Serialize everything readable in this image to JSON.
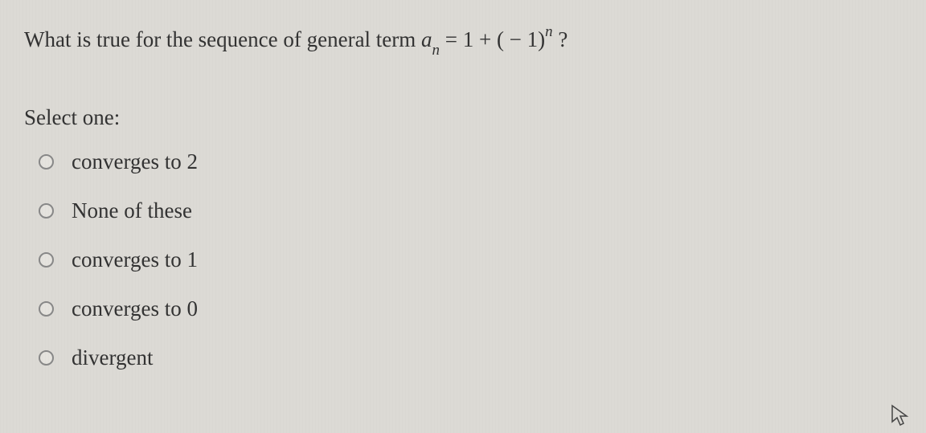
{
  "question": {
    "prefix": "What is true for the sequence of general term",
    "var": "a",
    "sub": "n",
    "mid": " = 1 + ( − 1)",
    "sup": "n",
    "suffix": "  ?"
  },
  "select_label": "Select one:",
  "options": [
    {
      "label": "converges to 2"
    },
    {
      "label": "None of these"
    },
    {
      "label": "converges to 1"
    },
    {
      "label": "converges to 0"
    },
    {
      "label": "divergent"
    }
  ]
}
